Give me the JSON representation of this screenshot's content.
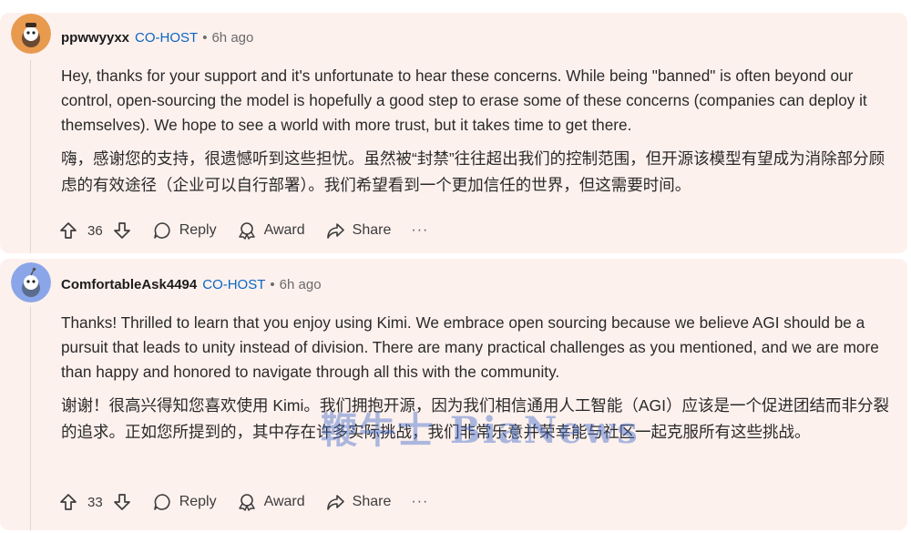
{
  "comments": [
    {
      "username": "ppwwyyxx",
      "flair": "CO-HOST",
      "separator": "•",
      "time": "6h ago",
      "avatar_color": "#e89a4f",
      "text_en": "Hey, thanks for your support and it's unfortunate to hear these concerns. While being \"banned\" is often beyond our control, open-sourcing the model is hopefully a good step to erase some of these concerns (companies can deploy it themselves). We hope to see a world with more trust, but it takes time to get there.",
      "text_zh": "嗨，感谢您的支持，很遗憾听到这些担忧。虽然被“封禁”往往超出我们的控制范围，但开源该模型有望成为消除部分顾虑的有效途径（企业可以自行部署）。我们希望看到一个更加信任的世界，但这需要时间。",
      "votes": "36",
      "reply_label": "Reply",
      "award_label": "Award",
      "share_label": "Share",
      "more_label": "···"
    },
    {
      "username": "ComfortableAsk4494",
      "flair": "CO-HOST",
      "separator": "•",
      "time": "6h ago",
      "avatar_color": "#8aa6e8",
      "text_en": "Thanks! Thrilled to learn that you enjoy using Kimi. We embrace open sourcing because we believe AGI should be a pursuit that leads to unity instead of division. There are many practical challenges as you mentioned, and we are more than happy and honored to navigate through all this with the community.",
      "text_zh": "谢谢！很高兴得知您喜欢使用 Kimi。我们拥抱开源，因为我们相信通用人工智能（AGI）应该是一个促进团结而非分裂的追求。正如您所提到的，其中存在许多实际挑战，我们非常乐意并荣幸能与社区一起克服所有这些挑战。",
      "votes": "33",
      "reply_label": "Reply",
      "award_label": "Award",
      "share_label": "Share",
      "more_label": "···"
    }
  ],
  "watermark": "鞭牛士 BiaNews"
}
